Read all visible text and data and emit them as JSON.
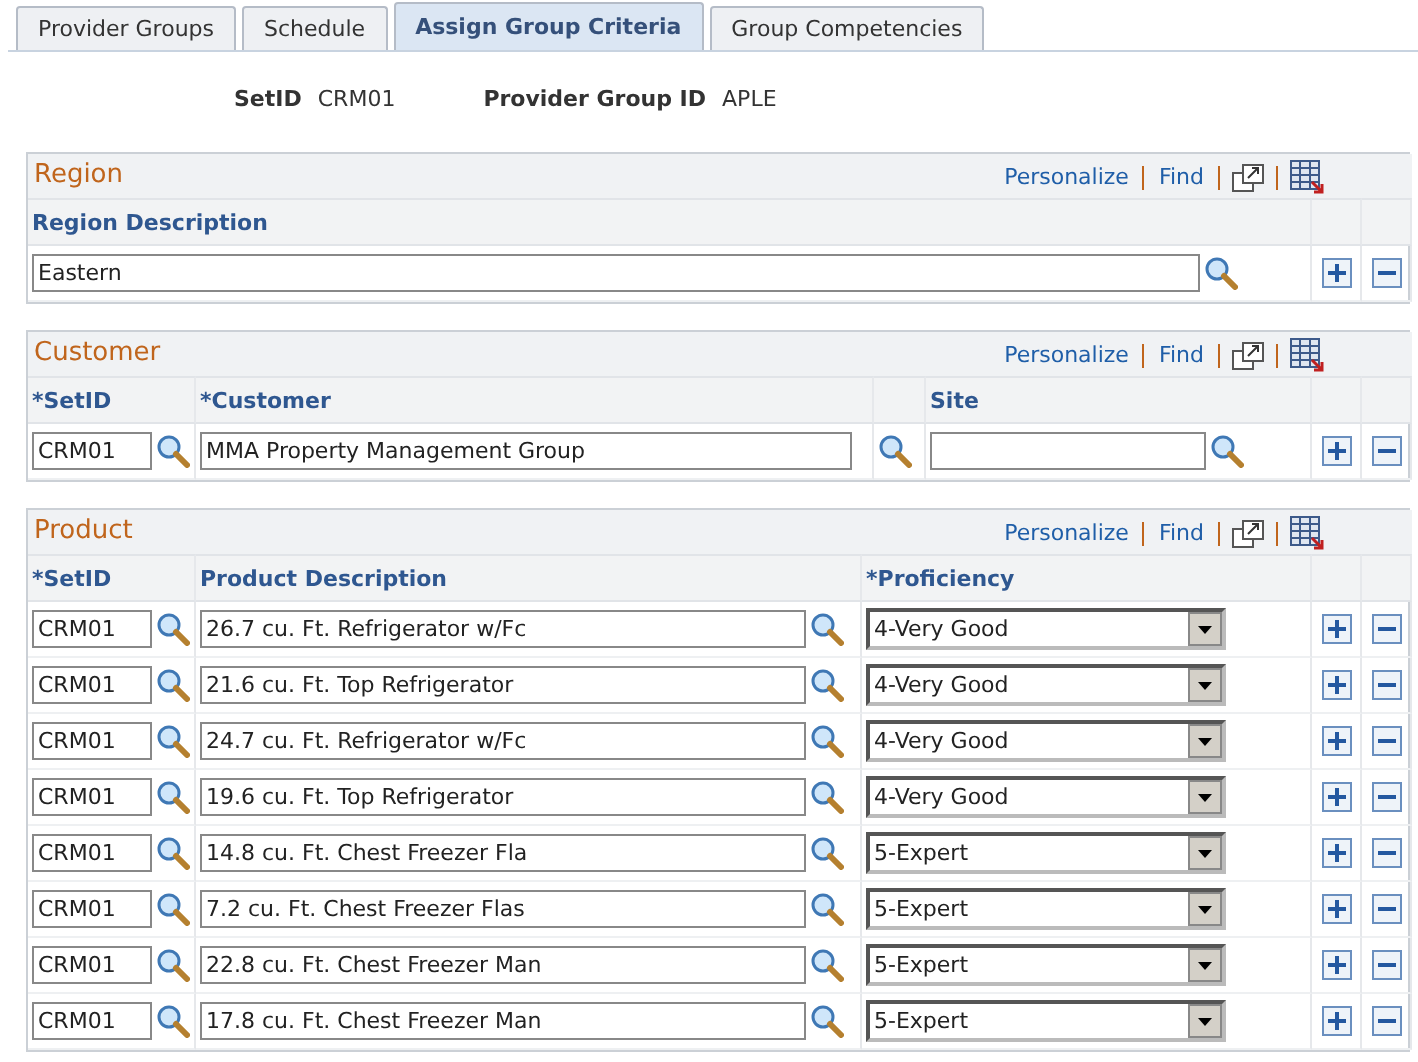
{
  "tabs": [
    {
      "label": "Provider Groups",
      "selected": false
    },
    {
      "label": "Schedule",
      "selected": false
    },
    {
      "label": "Assign Group Criteria",
      "selected": true
    },
    {
      "label": "Group Competencies",
      "selected": false
    }
  ],
  "header": [
    {
      "label": "SetID",
      "value": "CRM01"
    },
    {
      "label": "Provider Group ID",
      "value": "APLE"
    }
  ],
  "region": {
    "title": "Region",
    "links": [
      "Personalize",
      "Find"
    ],
    "columns": [
      "Region Description"
    ],
    "rows": [
      {
        "description": "Eastern"
      }
    ]
  },
  "customer": {
    "title": "Customer",
    "links": [
      "Personalize",
      "Find"
    ],
    "columns": [
      "*SetID",
      "*Customer",
      "Site"
    ],
    "rows": [
      {
        "setid": "CRM01",
        "customer": "MMA Property Management Group"
      }
    ]
  },
  "product": {
    "title": "Product",
    "links": [
      "Personalize",
      "Find"
    ],
    "columns": [
      "*SetID",
      "Product Description",
      "*Proficiency"
    ],
    "rows": [
      {
        "setid": "CRM01",
        "description": "26.7 cu. Ft. Refrigerator w/Fc",
        "proficiency": "4-Very Good"
      },
      {
        "setid": "CRM01",
        "description": "21.6 cu. Ft. Top Refrigerator",
        "proficiency": "4-Very Good"
      },
      {
        "setid": "CRM01",
        "description": "24.7 cu. Ft. Refrigerator w/Fc",
        "proficiency": "4-Very Good"
      },
      {
        "setid": "CRM01",
        "description": "19.6 cu. Ft. Top Refrigerator",
        "proficiency": "4-Very Good"
      },
      {
        "setid": "CRM01",
        "description": "14.8 cu. Ft. Chest Freezer Fla",
        "proficiency": "5-Expert"
      },
      {
        "setid": "CRM01",
        "description": "7.2 cu. Ft. Chest Freezer Flas",
        "proficiency": "5-Expert"
      },
      {
        "setid": "CRM01",
        "description": "22.8 cu. Ft. Chest Freezer Man",
        "proficiency": "5-Expert"
      },
      {
        "setid": "CRM01",
        "description": "17.8 cu. Ft. Chest Freezer Man",
        "proficiency": "5-Expert"
      }
    ]
  }
}
